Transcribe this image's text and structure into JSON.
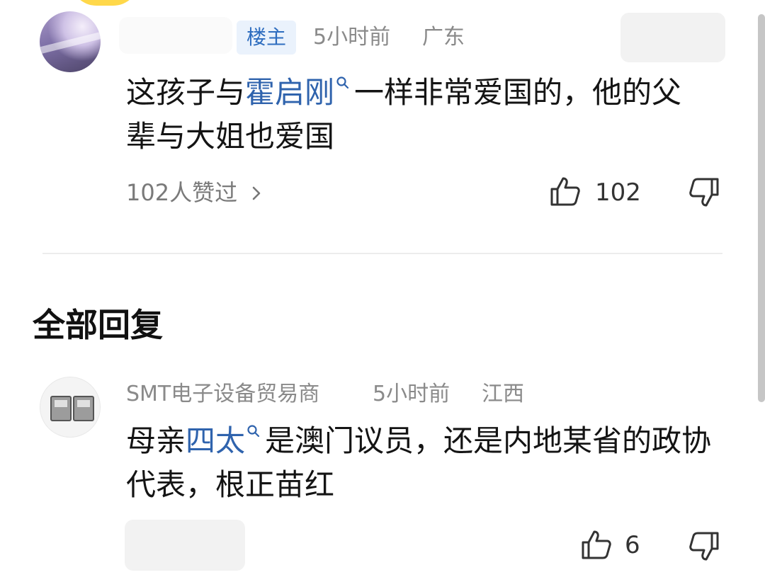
{
  "main_comment": {
    "owner_badge": "楼主",
    "time": "5小时前",
    "location": "广东",
    "text_before": "这孩子与",
    "keyword": "霍启刚",
    "text_after": "一样非常爱国的，他的父辈与大姐也爱国",
    "likes_summary": "102人赞过",
    "like_count": "102"
  },
  "section": {
    "title": "全部回复"
  },
  "reply": {
    "author": "SMT电子设备贸易商",
    "time": "5小时前",
    "location": "江西",
    "text_before": "母亲",
    "keyword": "四太",
    "text_after": "是澳门议员，还是内地某省的政协代表，根正苗红",
    "like_count": "6"
  },
  "icons": {
    "keyword_search": "search-icon",
    "like": "thumbs-up-icon",
    "dislike": "thumbs-down-icon",
    "chevron": "chevron-right-icon"
  },
  "colors": {
    "keyword": "#2f63ad",
    "badge_bg": "#eaf2fc",
    "badge_text": "#2e6dbf",
    "meta_text": "#8a8a8a"
  }
}
